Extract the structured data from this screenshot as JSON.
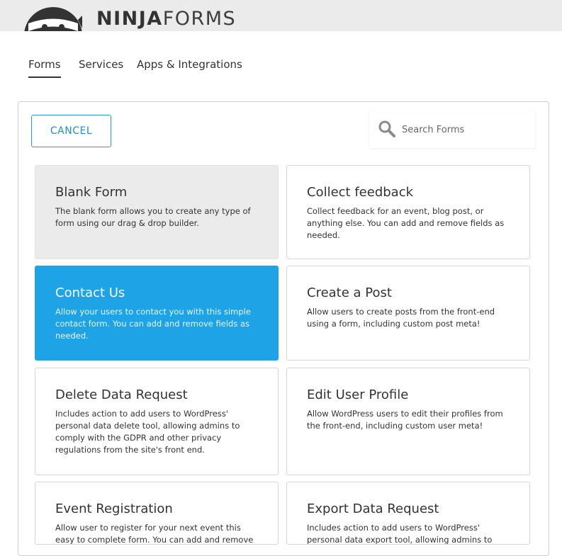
{
  "brand": {
    "logo_bold": "NINJA",
    "logo_light": "FORMS"
  },
  "tabs": [
    {
      "label": "Forms",
      "active": true
    },
    {
      "label": "Services",
      "active": false
    },
    {
      "label": "Apps & Integrations",
      "active": false
    }
  ],
  "toolbar": {
    "cancel_label": "CANCEL"
  },
  "search": {
    "placeholder": "Search Forms",
    "value": ""
  },
  "templates": [
    {
      "title": "Blank Form",
      "description": "The blank form allows you to create any type of form using our drag & drop builder."
    },
    {
      "title": "Collect feedback",
      "description": "Collect feedback for an event, blog post, or anything else. You can add and remove fields as needed."
    },
    {
      "title": "Contact Us",
      "description": "Allow your users to contact you with this simple contact form. You can add and remove fields as needed."
    },
    {
      "title": "Create a Post",
      "description": "Allow users to create posts from the front-end using a form, including custom post meta!"
    },
    {
      "title": "Delete Data Request",
      "description": "Includes action to add users to WordPress' personal data delete tool, allowing admins to comply with the GDPR and other privacy regulations from the site's front end."
    },
    {
      "title": "Edit User Profile",
      "description": "Allow WordPress users to edit their profiles from the front-end, including custom user meta!"
    },
    {
      "title": "Event Registration",
      "description": "Allow user to register for your next event this easy to complete form. You can add and remove fields as"
    },
    {
      "title": "Export Data Request",
      "description": "Includes action to add users to WordPress' personal data export tool, allowing admins to comply with the"
    }
  ],
  "colors": {
    "accent": "#1ea4e6",
    "cancel_border": "#2a9bd6",
    "blank_card_bg": "#ebebeb",
    "header_bg": "#ebebeb"
  },
  "icons": {
    "logo": "ninja-head-icon",
    "search": "search-icon"
  }
}
